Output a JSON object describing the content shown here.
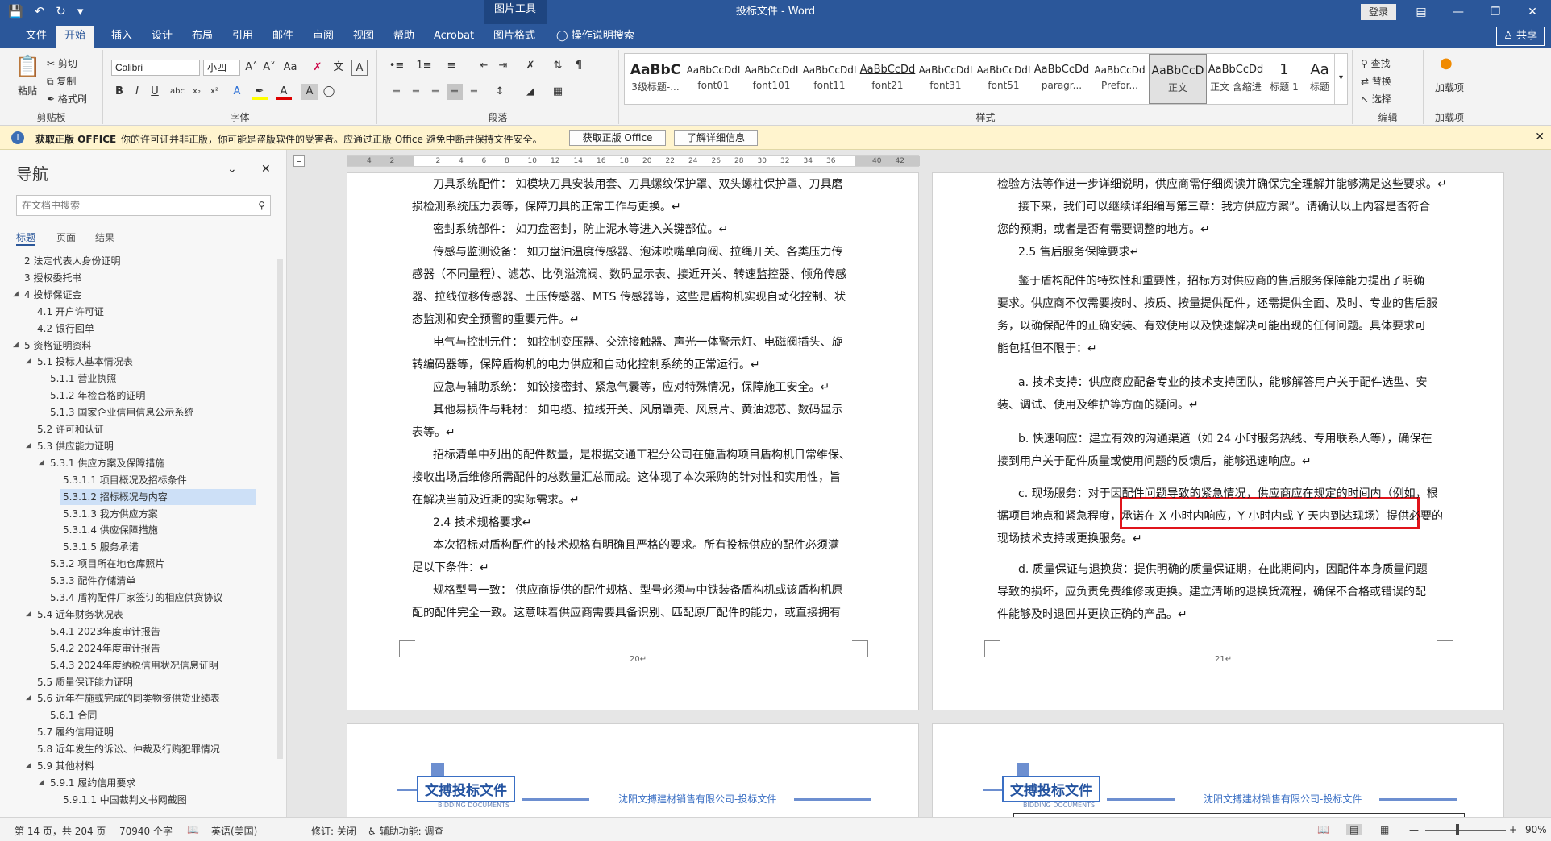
{
  "titlebar": {
    "context_tab": "图片工具",
    "title": "投标文件 - Word",
    "login": "登录"
  },
  "tabs": [
    "文件",
    "开始",
    "插入",
    "设计",
    "布局",
    "引用",
    "邮件",
    "审阅",
    "视图",
    "帮助",
    "Acrobat",
    "图片格式"
  ],
  "tell_me": "操作说明搜索",
  "share": "共享",
  "ribbon": {
    "clipboard": {
      "paste": "粘贴",
      "cut": "剪切",
      "copy": "复制",
      "format_painter": "格式刷",
      "label": "剪贴板"
    },
    "font": {
      "name": "Calibri",
      "size": "小四",
      "label": "字体",
      "bold": "B",
      "italic": "I",
      "underline": "U"
    },
    "paragraph": {
      "label": "段落"
    },
    "styles": {
      "label": "样式",
      "items": [
        {
          "preview": "AaBbC",
          "name": "3级标题-..."
        },
        {
          "preview": "AaBbCcDdI",
          "name": "font01"
        },
        {
          "preview": "AaBbCcDdI",
          "name": "font101"
        },
        {
          "preview": "AaBbCcDdI",
          "name": "font11"
        },
        {
          "preview": "AaBbCcDd",
          "name": "font21"
        },
        {
          "preview": "AaBbCcDdI",
          "name": "font31"
        },
        {
          "preview": "AaBbCcDdI",
          "name": "font51"
        },
        {
          "preview": "AaBbCcDd",
          "name": "paragr..."
        },
        {
          "preview": "AaBbCcDd",
          "name": "Prefor..."
        },
        {
          "preview": "AaBbCcD",
          "name": "正文"
        },
        {
          "preview": "AaBbCcDd",
          "name": "正文 含缩进"
        },
        {
          "preview": "1",
          "name": "标题 1"
        },
        {
          "preview": "Aa",
          "name": "标题"
        }
      ]
    },
    "editing": {
      "find": "查找",
      "replace": "替换",
      "select": "选择",
      "label": "编辑"
    },
    "addins": {
      "item": "加载项",
      "label": "加载项"
    }
  },
  "notice": {
    "bold": "获取正版 OFFICE",
    "text": "你的许可证并非正版，你可能是盗版软件的受害者。应通过正版 Office 避免中断并保持文件安全。",
    "btn1": "获取正版 Office",
    "btn2": "了解详细信息"
  },
  "nav": {
    "title": "导航",
    "search_placeholder": "在文档中搜索",
    "tabs": [
      "标题",
      "页面",
      "结果"
    ],
    "items": [
      {
        "t": "2 法定代表人身份证明",
        "l": 1,
        "x": false
      },
      {
        "t": "3 授权委托书",
        "l": 1,
        "x": false
      },
      {
        "t": "4 投标保证金",
        "l": 1,
        "x": true
      },
      {
        "t": "4.1 开户许可证",
        "l": 2,
        "x": false
      },
      {
        "t": "4.2 银行回单",
        "l": 2,
        "x": false
      },
      {
        "t": "5 资格证明资料",
        "l": 1,
        "x": true
      },
      {
        "t": "5.1 投标人基本情况表",
        "l": 2,
        "x": true
      },
      {
        "t": "5.1.1 营业执照",
        "l": 3,
        "x": false
      },
      {
        "t": "5.1.2 年检合格的证明",
        "l": 3,
        "x": false
      },
      {
        "t": "5.1.3 国家企业信用信息公示系统",
        "l": 3,
        "x": false
      },
      {
        "t": "5.2 许可和认证",
        "l": 2,
        "x": false
      },
      {
        "t": "5.3 供应能力证明",
        "l": 2,
        "x": true
      },
      {
        "t": "5.3.1 供应方案及保障措施",
        "l": 3,
        "x": true
      },
      {
        "t": "5.3.1.1 项目概况及招标条件",
        "l": 4,
        "x": false
      },
      {
        "t": "5.3.1.2 招标概况与内容",
        "l": 4,
        "x": false,
        "sel": true
      },
      {
        "t": "5.3.1.3 我方供应方案",
        "l": 4,
        "x": false
      },
      {
        "t": "5.3.1.4 供应保障措施",
        "l": 4,
        "x": false
      },
      {
        "t": "5.3.1.5 服务承诺",
        "l": 4,
        "x": false
      },
      {
        "t": "5.3.2 项目所在地仓库照片",
        "l": 3,
        "x": false
      },
      {
        "t": "5.3.3 配件存储清单",
        "l": 3,
        "x": false
      },
      {
        "t": "5.3.4 盾构配件厂家签订的相应供货协议",
        "l": 3,
        "x": false
      },
      {
        "t": "5.4 近年财务状况表",
        "l": 2,
        "x": true
      },
      {
        "t": "5.4.1 2023年度审计报告",
        "l": 3,
        "x": false
      },
      {
        "t": "5.4.2 2024年度审计报告",
        "l": 3,
        "x": false
      },
      {
        "t": "5.4.3 2024年度纳税信用状况信息证明",
        "l": 3,
        "x": false
      },
      {
        "t": "5.5 质量保证能力证明",
        "l": 2,
        "x": false
      },
      {
        "t": "5.6 近年在施或完成的同类物资供货业绩表",
        "l": 2,
        "x": true
      },
      {
        "t": "5.6.1 合同",
        "l": 3,
        "x": false
      },
      {
        "t": "5.7 履约信用证明",
        "l": 2,
        "x": false
      },
      {
        "t": "5.8 近年发生的诉讼、仲裁及行贿犯罪情况",
        "l": 2,
        "x": false
      },
      {
        "t": "5.9 其他材料",
        "l": 2,
        "x": true
      },
      {
        "t": "5.9.1 履约信用要求",
        "l": 3,
        "x": true
      },
      {
        "t": "5.9.1.1 中国裁判文书网截图",
        "l": 4,
        "x": false
      }
    ]
  },
  "ruler": [
    "4",
    "2",
    "",
    "2",
    "4",
    "6",
    "8",
    "10",
    "12",
    "14",
    "16",
    "18",
    "20",
    "22",
    "24",
    "26",
    "28",
    "30",
    "32",
    "34",
    "36",
    "",
    "40",
    "42"
  ],
  "page_left": {
    "number": "20↵",
    "lines": [
      "刀具系统配件： 如模块刀具安装用套、刀具螺纹保护罩、双头螺柱保护罩、刀具磨",
      "损检测系统压力表等，保障刀具的正常工作与更换。↵",
      "密封系统部件： 如刀盘密封，防止泥水等进入关键部位。↵",
      "传感与监测设备： 如刀盘油温度传感器、泡沫喷嘴单向阀、拉绳开关、各类压力传",
      "感器（不同量程）、滤芯、比例溢流阀、数码显示表、接近开关、转速监控器、倾角传感",
      "器、拉线位移传感器、土压传感器、MTS 传感器等，这些是盾构机实现自动化控制、状",
      "态监测和安全预警的重要元件。↵",
      "电气与控制元件： 如控制变压器、交流接触器、声光一体警示灯、电磁阀插头、旋",
      "转编码器等，保障盾构机的电力供应和自动化控制系统的正常运行。↵",
      "应急与辅助系统： 如铰接密封、紧急气囊等，应对特殊情况，保障施工安全。↵",
      "其他易损件与耗材： 如电缆、拉线开关、风扇罩壳、风扇片、黄油滤芯、数码显示",
      "表等。↵",
      "招标清单中列出的配件数量，是根据交通工程分公司在施盾构项目盾构机日常维保、",
      "接收出场后维修所需配件的总数量汇总而成。这体现了本次采购的针对性和实用性，旨",
      "在解决当前及近期的实际需求。↵",
      "2.4 技术规格要求↵",
      "本次招标对盾构配件的技术规格有明确且严格的要求。所有投标供应的配件必须满",
      "足以下条件：↵",
      "规格型号一致： 供应商提供的配件规格、型号必须与中铁装备盾构机或该盾构机原",
      "配的配件完全一致。这意味着供应商需要具备识别、匹配原厂配件的能力，或直接拥有"
    ]
  },
  "page_right": {
    "number": "21↵",
    "lines": [
      "检验方法等作进一步详细说明，供应商需仔细阅读并确保完全理解并能够满足这些要求。↵",
      "接下来，我们可以继续详细编写第三章：我方供应方案”。请确认以上内容是否符合",
      "您的预期，或者是否有需要调整的地方。↵",
      "2.5 售后服务保障要求↵",
      "鉴于盾构配件的特殊性和重要性，招标方对供应商的售后服务保障能力提出了明确",
      "要求。供应商不仅需要按时、按质、按量提供配件，还需提供全面、及时、专业的售后服",
      "务，以确保配件的正确安装、有效使用以及快速解决可能出现的任何问题。具体要求可",
      "能包括但不限于：↵",
      "a. 技术支持：供应商应配备专业的技术支持团队，能够解答用户关于配件选型、安",
      "装、调试、使用及维护等方面的疑问。↵",
      "b. 快速响应：建立有效的沟通渠道（如 24 小时服务热线、专用联系人等），确保在",
      "接到用户关于配件质量或使用问题的反馈后，能够迅速响应。↵",
      "c. 现场服务：对于因配件问题导致的紧急情况，供应商应在规定的时间内（例如，根",
      "据项目地点和紧急程度，承诺在 X 小时内响应，Y 小时内或 Y 天内到达现场）提供必要的",
      "现场技术支持或更换服务。↵",
      "d. 质量保证与退换货：提供明确的质量保证期，在此期间内，因配件本身质量问题",
      "导致的损坏，应负责免费维修或更换。建立清晰的退换货流程，确保不合格或错误的配",
      "件能够及时退回并更换正确的产品。↵"
    ]
  },
  "header_block": {
    "logo": "文搏投标文件",
    "sub": "BIDDING DOCUMENTS",
    "company": "沈阳文搏建材销售有限公司-投标文件"
  },
  "status": {
    "page": "第 14 页，共 204 页",
    "words": "70940 个字",
    "lang": "英语(美国)",
    "track": "修订: 关闭",
    "access": "辅助功能: 调查",
    "zoom": "90%"
  }
}
